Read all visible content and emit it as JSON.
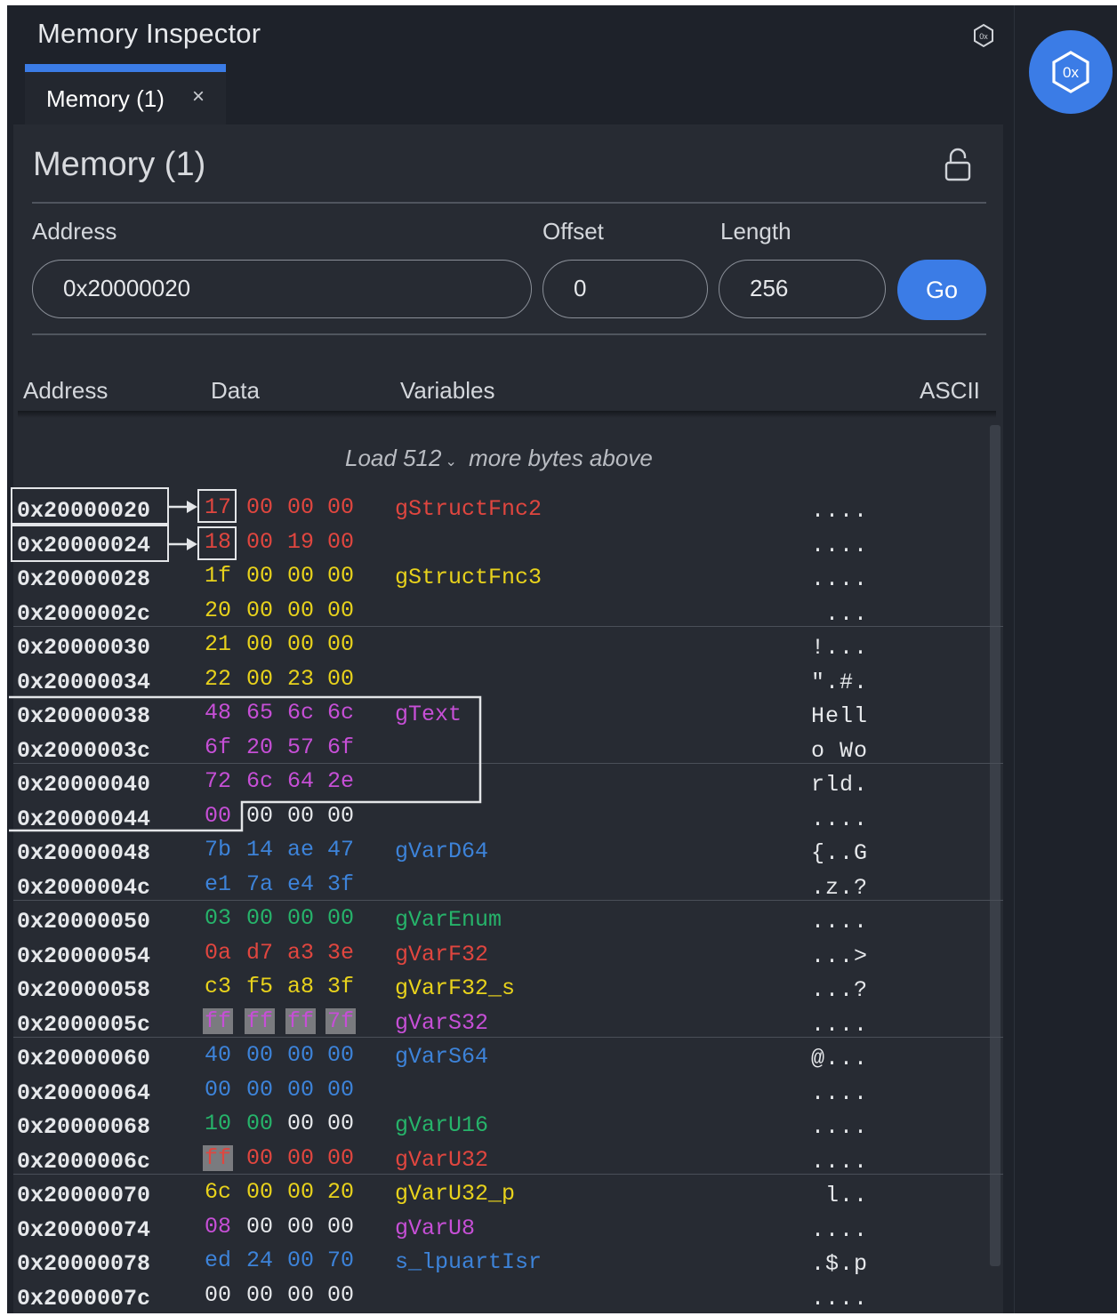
{
  "panel": {
    "title": "Memory Inspector"
  },
  "tab": {
    "label": "Memory (1)",
    "close": "×"
  },
  "view": {
    "title": "Memory (1)",
    "address_label": "Address",
    "offset_label": "Offset",
    "length_label": "Length",
    "address_value": "0x20000020",
    "offset_value": "0",
    "length_value": "256",
    "go_label": "Go"
  },
  "columns": {
    "address": "Address",
    "data": "Data",
    "variables": "Variables",
    "ascii": "ASCII"
  },
  "load_more": {
    "prefix": "Load",
    "count": "512",
    "suffix": "more bytes above"
  },
  "colors": {
    "accent": "#3b7ce6",
    "red": "#e0463f",
    "yellow": "#e8d21c",
    "magenta": "#c64fd6",
    "blue": "#3d83d9",
    "green": "#26b36a",
    "white": "#e6e8eb"
  },
  "rows": [
    {
      "addr": "0x20000020",
      "bytes": [
        [
          "17",
          "red"
        ],
        [
          "00",
          "red"
        ],
        [
          "00",
          "red"
        ],
        [
          "00",
          "red"
        ]
      ],
      "var": "gStructFnc2",
      "var_color": "red",
      "ascii": "...."
    },
    {
      "addr": "0x20000024",
      "bytes": [
        [
          "18",
          "red"
        ],
        [
          "00",
          "red"
        ],
        [
          "19",
          "red"
        ],
        [
          "00",
          "red"
        ]
      ],
      "var": "",
      "var_color": "red",
      "ascii": "...."
    },
    {
      "addr": "0x20000028",
      "bytes": [
        [
          "1f",
          "yellow"
        ],
        [
          "00",
          "yellow"
        ],
        [
          "00",
          "yellow"
        ],
        [
          "00",
          "yellow"
        ]
      ],
      "var": "gStructFnc3",
      "var_color": "yellow",
      "ascii": "...."
    },
    {
      "addr": "0x2000002c",
      "bytes": [
        [
          "20",
          "yellow"
        ],
        [
          "00",
          "yellow"
        ],
        [
          "00",
          "yellow"
        ],
        [
          "00",
          "yellow"
        ]
      ],
      "var": "",
      "var_color": "yellow",
      "ascii": "..."
    },
    {
      "addr": "0x20000030",
      "bytes": [
        [
          "21",
          "yellow"
        ],
        [
          "00",
          "yellow"
        ],
        [
          "00",
          "yellow"
        ],
        [
          "00",
          "yellow"
        ]
      ],
      "var": "",
      "var_color": "yellow",
      "ascii": "!..."
    },
    {
      "addr": "0x20000034",
      "bytes": [
        [
          "22",
          "yellow"
        ],
        [
          "00",
          "yellow"
        ],
        [
          "23",
          "yellow"
        ],
        [
          "00",
          "yellow"
        ]
      ],
      "var": "",
      "var_color": "yellow",
      "ascii": "\".#."
    },
    {
      "addr": "0x20000038",
      "bytes": [
        [
          "48",
          "magenta"
        ],
        [
          "65",
          "magenta"
        ],
        [
          "6c",
          "magenta"
        ],
        [
          "6c",
          "magenta"
        ]
      ],
      "var": "gText",
      "var_color": "magenta",
      "ascii": "Hell"
    },
    {
      "addr": "0x2000003c",
      "bytes": [
        [
          "6f",
          "magenta"
        ],
        [
          "20",
          "magenta"
        ],
        [
          "57",
          "magenta"
        ],
        [
          "6f",
          "magenta"
        ]
      ],
      "var": "",
      "var_color": "magenta",
      "ascii": "o Wo"
    },
    {
      "addr": "0x20000040",
      "bytes": [
        [
          "72",
          "magenta"
        ],
        [
          "6c",
          "magenta"
        ],
        [
          "64",
          "magenta"
        ],
        [
          "2e",
          "magenta"
        ]
      ],
      "var": "",
      "var_color": "magenta",
      "ascii": "rld."
    },
    {
      "addr": "0x20000044",
      "bytes": [
        [
          "00",
          "magenta"
        ],
        [
          "00",
          "white"
        ],
        [
          "00",
          "white"
        ],
        [
          "00",
          "white"
        ]
      ],
      "var": "",
      "var_color": "white",
      "ascii": "...."
    },
    {
      "addr": "0x20000048",
      "bytes": [
        [
          "7b",
          "blue"
        ],
        [
          "14",
          "blue"
        ],
        [
          "ae",
          "blue"
        ],
        [
          "47",
          "blue"
        ]
      ],
      "var": "gVarD64",
      "var_color": "blue",
      "ascii": "{..G"
    },
    {
      "addr": "0x2000004c",
      "bytes": [
        [
          "e1",
          "blue"
        ],
        [
          "7a",
          "blue"
        ],
        [
          "e4",
          "blue"
        ],
        [
          "3f",
          "blue"
        ]
      ],
      "var": "",
      "var_color": "blue",
      "ascii": ".z.?"
    },
    {
      "addr": "0x20000050",
      "bytes": [
        [
          "03",
          "green"
        ],
        [
          "00",
          "green"
        ],
        [
          "00",
          "green"
        ],
        [
          "00",
          "green"
        ]
      ],
      "var": "gVarEnum",
      "var_color": "green",
      "ascii": "...."
    },
    {
      "addr": "0x20000054",
      "bytes": [
        [
          "0a",
          "red"
        ],
        [
          "d7",
          "red"
        ],
        [
          "a3",
          "red"
        ],
        [
          "3e",
          "red"
        ]
      ],
      "var": "gVarF32",
      "var_color": "red",
      "ascii": "...>"
    },
    {
      "addr": "0x20000058",
      "bytes": [
        [
          "c3",
          "yellow"
        ],
        [
          "f5",
          "yellow"
        ],
        [
          "a8",
          "yellow"
        ],
        [
          "3f",
          "yellow"
        ]
      ],
      "var": "gVarF32_s",
      "var_color": "yellow",
      "ascii": "...?"
    },
    {
      "addr": "0x2000005c",
      "bytes": [
        [
          "ff",
          "magenta",
          "hl"
        ],
        [
          "ff",
          "magenta",
          "hl"
        ],
        [
          "ff",
          "magenta",
          "hl"
        ],
        [
          "7f",
          "magenta",
          "hl"
        ]
      ],
      "var": "gVarS32",
      "var_color": "magenta",
      "ascii": "...."
    },
    {
      "addr": "0x20000060",
      "bytes": [
        [
          "40",
          "blue"
        ],
        [
          "00",
          "blue"
        ],
        [
          "00",
          "blue"
        ],
        [
          "00",
          "blue"
        ]
      ],
      "var": "gVarS64",
      "var_color": "blue",
      "ascii": "@..."
    },
    {
      "addr": "0x20000064",
      "bytes": [
        [
          "00",
          "blue"
        ],
        [
          "00",
          "blue"
        ],
        [
          "00",
          "blue"
        ],
        [
          "00",
          "blue"
        ]
      ],
      "var": "",
      "var_color": "blue",
      "ascii": "...."
    },
    {
      "addr": "0x20000068",
      "bytes": [
        [
          "10",
          "green"
        ],
        [
          "00",
          "green"
        ],
        [
          "00",
          "white"
        ],
        [
          "00",
          "white"
        ]
      ],
      "var": "gVarU16",
      "var_color": "green",
      "ascii": "...."
    },
    {
      "addr": "0x2000006c",
      "bytes": [
        [
          "ff",
          "red",
          "hl"
        ],
        [
          "00",
          "red"
        ],
        [
          "00",
          "red"
        ],
        [
          "00",
          "red"
        ]
      ],
      "var": "gVarU32",
      "var_color": "red",
      "ascii": "...."
    },
    {
      "addr": "0x20000070",
      "bytes": [
        [
          "6c",
          "yellow"
        ],
        [
          "00",
          "yellow"
        ],
        [
          "00",
          "yellow"
        ],
        [
          "20",
          "yellow"
        ]
      ],
      "var": "gVarU32_p",
      "var_color": "yellow",
      "ascii": "l.."
    },
    {
      "addr": "0x20000074",
      "bytes": [
        [
          "08",
          "magenta"
        ],
        [
          "00",
          "white"
        ],
        [
          "00",
          "white"
        ],
        [
          "00",
          "white"
        ]
      ],
      "var": "gVarU8",
      "var_color": "magenta",
      "ascii": "...."
    },
    {
      "addr": "0x20000078",
      "bytes": [
        [
          "ed",
          "blue"
        ],
        [
          "24",
          "blue"
        ],
        [
          "00",
          "blue"
        ],
        [
          "70",
          "blue"
        ]
      ],
      "var": "s_lpuartIsr",
      "var_color": "blue",
      "ascii": ".$.p"
    },
    {
      "addr": "0x2000007c",
      "bytes": [
        [
          "00",
          "white"
        ],
        [
          "00",
          "white"
        ],
        [
          "00",
          "white"
        ],
        [
          "00",
          "white"
        ]
      ],
      "var": "",
      "var_color": "white",
      "ascii": "...."
    }
  ]
}
